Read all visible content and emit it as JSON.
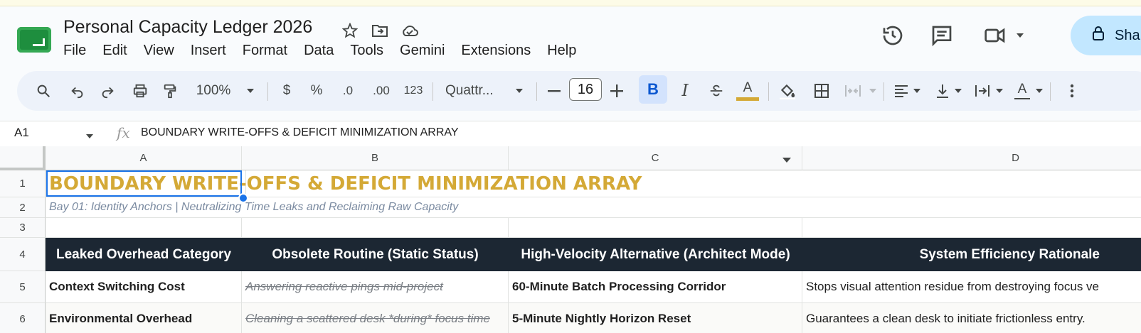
{
  "app": {
    "doc_title": "Personal Capacity Ledger 2026",
    "share_label": "Sha",
    "menu": [
      "File",
      "Edit",
      "View",
      "Insert",
      "Format",
      "Data",
      "Tools",
      "Gemini",
      "Extensions",
      "Help"
    ]
  },
  "toolbar": {
    "zoom": "100%",
    "currency": "$",
    "percent": "%",
    "dec_decrease": ".0",
    "dec_increase": ".00",
    "number_format": "123",
    "font_name": "Quattr...",
    "font_size": "16",
    "bold": "B",
    "italic": "I",
    "text_color": "A",
    "text_color_value": "#d4a936",
    "text_rotation": "A"
  },
  "formula_bar": {
    "cell_ref": "A1",
    "fx": "fx",
    "value": "BOUNDARY WRITE-OFFS & DEFICIT MINIMIZATION ARRAY"
  },
  "sheet": {
    "columns": [
      "A",
      "B",
      "C",
      "D"
    ],
    "rows": [
      "1",
      "2",
      "3",
      "4",
      "5",
      "6"
    ],
    "title": "BOUNDARY WRITE-OFFS & DEFICIT MINIMIZATION ARRAY",
    "subtitle": "Bay 01: Identity Anchors | Neutralizing Time Leaks and Reclaiming Raw Capacity",
    "headers": [
      "Leaked Overhead Category",
      "Obsolete Routine (Static Status)",
      "High-Velocity Alternative (Architect Mode)",
      "System Efficiency Rationale"
    ],
    "data": [
      [
        "Context Switching Cost",
        "Answering reactive pings mid-project",
        "60-Minute Batch Processing Corridor",
        "Stops visual attention residue from destroying focus ve"
      ],
      [
        "Environmental Overhead",
        "Cleaning a scattered desk *during* focus time",
        "5-Minute Nightly Horizon Reset",
        "Guarantees a clean desk to initiate frictionless entry."
      ]
    ],
    "colors": {
      "title": "#d4a936",
      "header_bg": "#1c2733",
      "selection": "#1a73e8"
    }
  }
}
